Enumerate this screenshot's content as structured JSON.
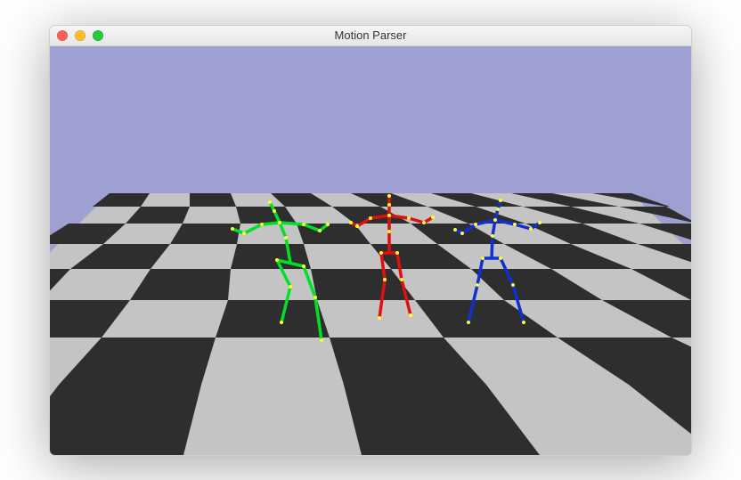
{
  "window": {
    "title": "Motion Parser",
    "controls": {
      "close_name": "close",
      "minimize_name": "minimize",
      "zoom_name": "zoom"
    }
  },
  "scene": {
    "background_sky": "#9da0d1",
    "floor_light": "#c4c4c4",
    "floor_dark": "#2e2e2e",
    "joint_color": "#ffff33",
    "skeletons": [
      {
        "id": "green",
        "color": "#00e02a"
      },
      {
        "id": "red",
        "color": "#e01010"
      },
      {
        "id": "blue",
        "color": "#1030d0"
      }
    ]
  }
}
